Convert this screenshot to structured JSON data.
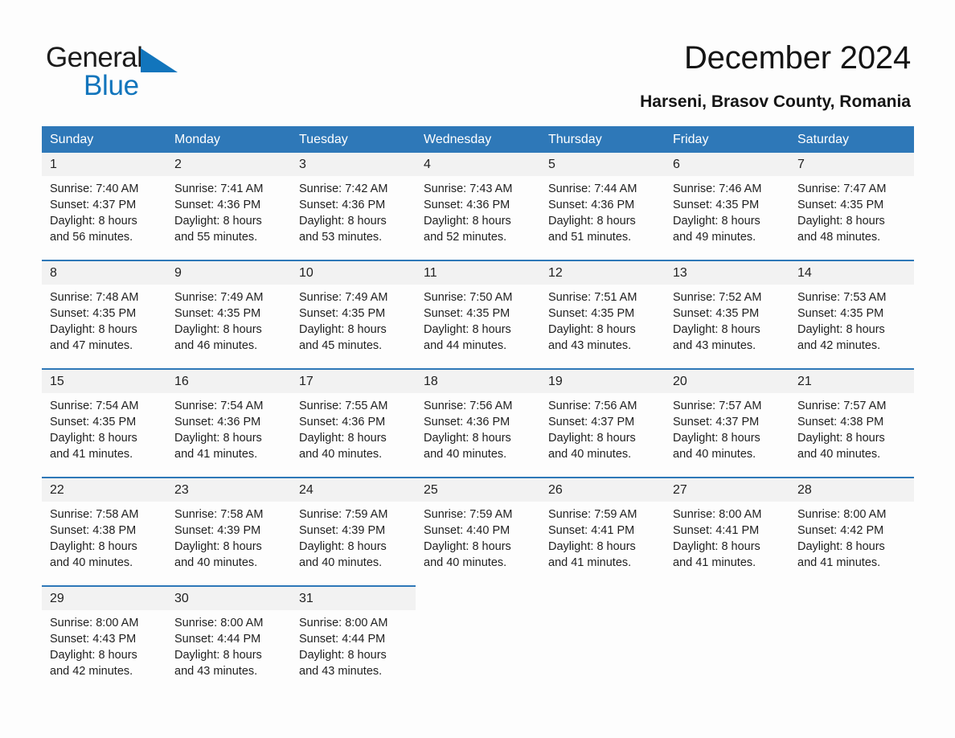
{
  "brand": {
    "name_part1": "General",
    "name_part2": "Blue",
    "triangle_color": "#1275bc",
    "logo_icon": "triangle-icon"
  },
  "header": {
    "title": "December 2024",
    "subtitle": "Harseni, Brasov County, Romania"
  },
  "colors": {
    "header_blue": "#2e78b8",
    "daynum_gray": "#f2f2f2",
    "page_bg": "#fdfdfd",
    "text": "#1f1f1f"
  },
  "calendar": {
    "weekday_headers": [
      "Sunday",
      "Monday",
      "Tuesday",
      "Wednesday",
      "Thursday",
      "Friday",
      "Saturday"
    ],
    "weeks": [
      [
        {
          "day": "1",
          "sunrise": "Sunrise: 7:40 AM",
          "sunset": "Sunset: 4:37 PM",
          "daylight_line1": "Daylight: 8 hours",
          "daylight_line2": "and 56 minutes."
        },
        {
          "day": "2",
          "sunrise": "Sunrise: 7:41 AM",
          "sunset": "Sunset: 4:36 PM",
          "daylight_line1": "Daylight: 8 hours",
          "daylight_line2": "and 55 minutes."
        },
        {
          "day": "3",
          "sunrise": "Sunrise: 7:42 AM",
          "sunset": "Sunset: 4:36 PM",
          "daylight_line1": "Daylight: 8 hours",
          "daylight_line2": "and 53 minutes."
        },
        {
          "day": "4",
          "sunrise": "Sunrise: 7:43 AM",
          "sunset": "Sunset: 4:36 PM",
          "daylight_line1": "Daylight: 8 hours",
          "daylight_line2": "and 52 minutes."
        },
        {
          "day": "5",
          "sunrise": "Sunrise: 7:44 AM",
          "sunset": "Sunset: 4:36 PM",
          "daylight_line1": "Daylight: 8 hours",
          "daylight_line2": "and 51 minutes."
        },
        {
          "day": "6",
          "sunrise": "Sunrise: 7:46 AM",
          "sunset": "Sunset: 4:35 PM",
          "daylight_line1": "Daylight: 8 hours",
          "daylight_line2": "and 49 minutes."
        },
        {
          "day": "7",
          "sunrise": "Sunrise: 7:47 AM",
          "sunset": "Sunset: 4:35 PM",
          "daylight_line1": "Daylight: 8 hours",
          "daylight_line2": "and 48 minutes."
        }
      ],
      [
        {
          "day": "8",
          "sunrise": "Sunrise: 7:48 AM",
          "sunset": "Sunset: 4:35 PM",
          "daylight_line1": "Daylight: 8 hours",
          "daylight_line2": "and 47 minutes."
        },
        {
          "day": "9",
          "sunrise": "Sunrise: 7:49 AM",
          "sunset": "Sunset: 4:35 PM",
          "daylight_line1": "Daylight: 8 hours",
          "daylight_line2": "and 46 minutes."
        },
        {
          "day": "10",
          "sunrise": "Sunrise: 7:49 AM",
          "sunset": "Sunset: 4:35 PM",
          "daylight_line1": "Daylight: 8 hours",
          "daylight_line2": "and 45 minutes."
        },
        {
          "day": "11",
          "sunrise": "Sunrise: 7:50 AM",
          "sunset": "Sunset: 4:35 PM",
          "daylight_line1": "Daylight: 8 hours",
          "daylight_line2": "and 44 minutes."
        },
        {
          "day": "12",
          "sunrise": "Sunrise: 7:51 AM",
          "sunset": "Sunset: 4:35 PM",
          "daylight_line1": "Daylight: 8 hours",
          "daylight_line2": "and 43 minutes."
        },
        {
          "day": "13",
          "sunrise": "Sunrise: 7:52 AM",
          "sunset": "Sunset: 4:35 PM",
          "daylight_line1": "Daylight: 8 hours",
          "daylight_line2": "and 43 minutes."
        },
        {
          "day": "14",
          "sunrise": "Sunrise: 7:53 AM",
          "sunset": "Sunset: 4:35 PM",
          "daylight_line1": "Daylight: 8 hours",
          "daylight_line2": "and 42 minutes."
        }
      ],
      [
        {
          "day": "15",
          "sunrise": "Sunrise: 7:54 AM",
          "sunset": "Sunset: 4:35 PM",
          "daylight_line1": "Daylight: 8 hours",
          "daylight_line2": "and 41 minutes."
        },
        {
          "day": "16",
          "sunrise": "Sunrise: 7:54 AM",
          "sunset": "Sunset: 4:36 PM",
          "daylight_line1": "Daylight: 8 hours",
          "daylight_line2": "and 41 minutes."
        },
        {
          "day": "17",
          "sunrise": "Sunrise: 7:55 AM",
          "sunset": "Sunset: 4:36 PM",
          "daylight_line1": "Daylight: 8 hours",
          "daylight_line2": "and 40 minutes."
        },
        {
          "day": "18",
          "sunrise": "Sunrise: 7:56 AM",
          "sunset": "Sunset: 4:36 PM",
          "daylight_line1": "Daylight: 8 hours",
          "daylight_line2": "and 40 minutes."
        },
        {
          "day": "19",
          "sunrise": "Sunrise: 7:56 AM",
          "sunset": "Sunset: 4:37 PM",
          "daylight_line1": "Daylight: 8 hours",
          "daylight_line2": "and 40 minutes."
        },
        {
          "day": "20",
          "sunrise": "Sunrise: 7:57 AM",
          "sunset": "Sunset: 4:37 PM",
          "daylight_line1": "Daylight: 8 hours",
          "daylight_line2": "and 40 minutes."
        },
        {
          "day": "21",
          "sunrise": "Sunrise: 7:57 AM",
          "sunset": "Sunset: 4:38 PM",
          "daylight_line1": "Daylight: 8 hours",
          "daylight_line2": "and 40 minutes."
        }
      ],
      [
        {
          "day": "22",
          "sunrise": "Sunrise: 7:58 AM",
          "sunset": "Sunset: 4:38 PM",
          "daylight_line1": "Daylight: 8 hours",
          "daylight_line2": "and 40 minutes."
        },
        {
          "day": "23",
          "sunrise": "Sunrise: 7:58 AM",
          "sunset": "Sunset: 4:39 PM",
          "daylight_line1": "Daylight: 8 hours",
          "daylight_line2": "and 40 minutes."
        },
        {
          "day": "24",
          "sunrise": "Sunrise: 7:59 AM",
          "sunset": "Sunset: 4:39 PM",
          "daylight_line1": "Daylight: 8 hours",
          "daylight_line2": "and 40 minutes."
        },
        {
          "day": "25",
          "sunrise": "Sunrise: 7:59 AM",
          "sunset": "Sunset: 4:40 PM",
          "daylight_line1": "Daylight: 8 hours",
          "daylight_line2": "and 40 minutes."
        },
        {
          "day": "26",
          "sunrise": "Sunrise: 7:59 AM",
          "sunset": "Sunset: 4:41 PM",
          "daylight_line1": "Daylight: 8 hours",
          "daylight_line2": "and 41 minutes."
        },
        {
          "day": "27",
          "sunrise": "Sunrise: 8:00 AM",
          "sunset": "Sunset: 4:41 PM",
          "daylight_line1": "Daylight: 8 hours",
          "daylight_line2": "and 41 minutes."
        },
        {
          "day": "28",
          "sunrise": "Sunrise: 8:00 AM",
          "sunset": "Sunset: 4:42 PM",
          "daylight_line1": "Daylight: 8 hours",
          "daylight_line2": "and 41 minutes."
        }
      ],
      [
        {
          "day": "29",
          "sunrise": "Sunrise: 8:00 AM",
          "sunset": "Sunset: 4:43 PM",
          "daylight_line1": "Daylight: 8 hours",
          "daylight_line2": "and 42 minutes."
        },
        {
          "day": "30",
          "sunrise": "Sunrise: 8:00 AM",
          "sunset": "Sunset: 4:44 PM",
          "daylight_line1": "Daylight: 8 hours",
          "daylight_line2": "and 43 minutes."
        },
        {
          "day": "31",
          "sunrise": "Sunrise: 8:00 AM",
          "sunset": "Sunset: 4:44 PM",
          "daylight_line1": "Daylight: 8 hours",
          "daylight_line2": "and 43 minutes."
        },
        {
          "day": "",
          "sunrise": "",
          "sunset": "",
          "daylight_line1": "",
          "daylight_line2": ""
        },
        {
          "day": "",
          "sunrise": "",
          "sunset": "",
          "daylight_line1": "",
          "daylight_line2": ""
        },
        {
          "day": "",
          "sunrise": "",
          "sunset": "",
          "daylight_line1": "",
          "daylight_line2": ""
        },
        {
          "day": "",
          "sunrise": "",
          "sunset": "",
          "daylight_line1": "",
          "daylight_line2": ""
        }
      ]
    ]
  }
}
